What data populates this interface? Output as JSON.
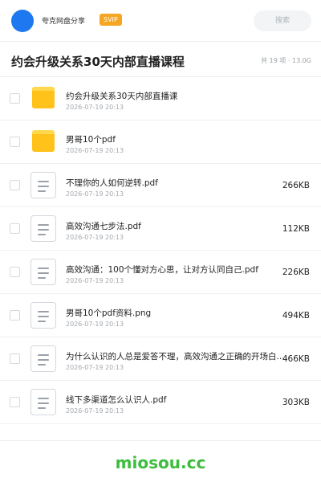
{
  "header": {
    "share_name": "夸克网盘分享",
    "badge": "SVIP",
    "search_placeholder": "搜索",
    "accent_color": "#1e78f0"
  },
  "folder": {
    "title": "约会升级关系30天内部直播课程",
    "summary": "共 19 项 · 13.0G"
  },
  "files": [
    {
      "name": "约会升级关系30天内部直播课",
      "date": "2026-07-19 20:13",
      "size": "",
      "icon": "folder-icon"
    },
    {
      "name": "男哥10个pdf",
      "date": "2026-07-19 20:13",
      "size": "",
      "icon": "folder-icon"
    },
    {
      "name": "不理你的人如何逆转.pdf",
      "date": "2026-07-19 20:13",
      "size": "266KB",
      "icon": "document-icon"
    },
    {
      "name": "高效沟通七步法.pdf",
      "date": "2026-07-19 20:13",
      "size": "112KB",
      "icon": "document-icon"
    },
    {
      "name": "高效沟通：100个懂对方心思，让对方认同自己.pdf",
      "date": "2026-07-19 20:13",
      "size": "226KB",
      "icon": "document-icon"
    },
    {
      "name": "男哥10个pdf资料.png",
      "date": "2026-07-19 20:13",
      "size": "494KB",
      "icon": "document-icon"
    },
    {
      "name": "为什么认识的人总是爱答不理，高效沟通之正确的开场白.pdf",
      "date": "2026-07-19 20:13",
      "size": "466KB",
      "icon": "document-icon"
    },
    {
      "name": "线下多渠道怎么认识人.pdf",
      "date": "2026-07-19 20:13",
      "size": "303KB",
      "icon": "document-icon"
    }
  ],
  "footer": {
    "watermark": "miosou.cc"
  }
}
